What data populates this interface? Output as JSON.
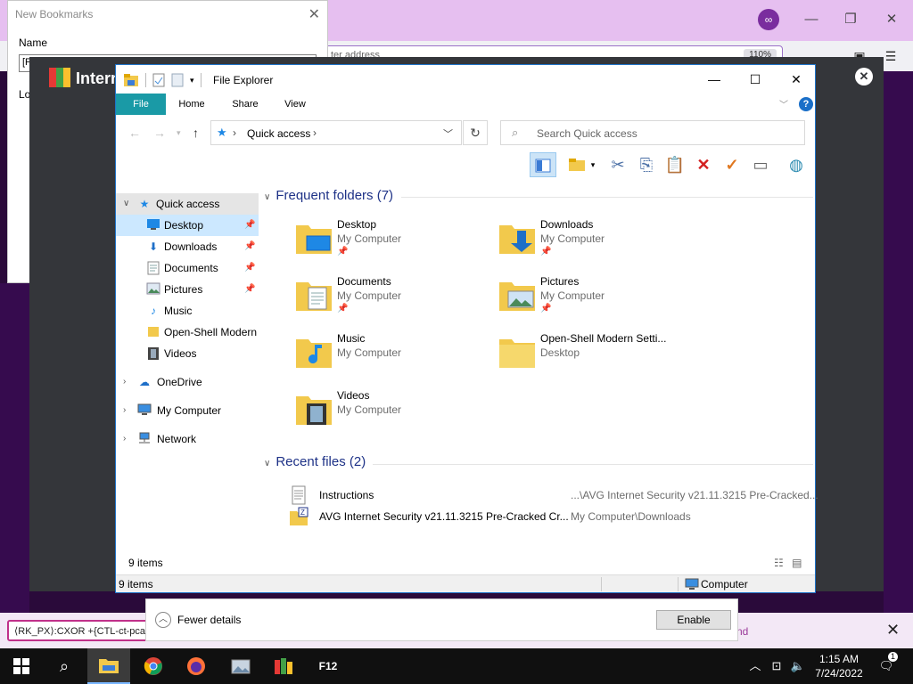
{
  "firefox": {
    "url_text": "ter address",
    "zoom": "110%"
  },
  "bookmark_dialog": {
    "title": "New Bookmarks",
    "name_label": "Name",
    "name_value": "[F",
    "location_label": "Lo"
  },
  "avg": {
    "title": "Intern"
  },
  "explorer": {
    "title": "File Explorer",
    "ribbon_tabs": [
      "File",
      "Home",
      "Share",
      "View"
    ],
    "address": "Quick access",
    "search_placeholder": "Search Quick access",
    "nav": {
      "quick_access": "Quick access",
      "pinned": [
        "Desktop",
        "Downloads",
        "Documents",
        "Pictures"
      ],
      "others": [
        "Music",
        "Open-Shell Modern",
        "Videos"
      ],
      "onedrive": "OneDrive",
      "my_computer": "My Computer",
      "network": "Network"
    },
    "frequent_header": "Frequent folders (7)",
    "frequent": [
      {
        "name": "Desktop",
        "location": "My Computer",
        "pinned": true,
        "icon": "desktop-folder-icon"
      },
      {
        "name": "Downloads",
        "location": "My Computer",
        "pinned": true,
        "icon": "downloads-folder-icon"
      },
      {
        "name": "Documents",
        "location": "My Computer",
        "pinned": true,
        "icon": "documents-folder-icon"
      },
      {
        "name": "Pictures",
        "location": "My Computer",
        "pinned": true,
        "icon": "pictures-folder-icon"
      },
      {
        "name": "Music",
        "location": "My Computer",
        "pinned": false,
        "icon": "music-folder-icon"
      },
      {
        "name": "Open-Shell Modern Setti...",
        "location": "Desktop",
        "pinned": false,
        "icon": "folder-icon"
      },
      {
        "name": "Videos",
        "location": "My Computer",
        "pinned": false,
        "icon": "videos-folder-icon"
      }
    ],
    "recent_header": "Recent files (2)",
    "recent": [
      {
        "name": "Instructions",
        "path": "...\\AVG Internet Security v21.11.3215 Pre-Cracked..."
      },
      {
        "name": "AVG Internet Security v21.11.3215 Pre-Cracked Cr...",
        "path": "My Computer\\Downloads"
      }
    ],
    "items_count": "9 items",
    "status_left": "9 items",
    "status_right": "Computer"
  },
  "notification": {
    "red_text": "⟨RK_PX⟩:CXOR +{CTL-ct-pcap",
    "tail_text": "nd",
    "fewer_details": "Fewer details",
    "enable_label": "Enable"
  },
  "taskbar": {
    "f12_label": "F12",
    "time": "1:15 AM",
    "date": "7/24/2022",
    "notifications_count": "1"
  },
  "colors": {
    "accent": "#1a9aa6",
    "link_header": "#1e3287",
    "selection": "#cce8ff",
    "firefox_tab": "#e6bff0",
    "desktop_purple": "#360b4e"
  }
}
